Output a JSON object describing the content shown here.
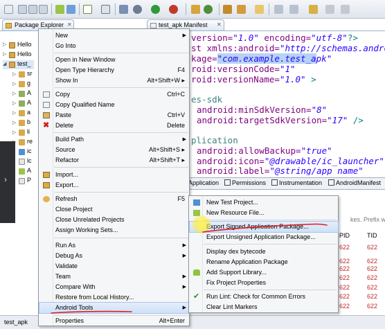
{
  "colors": {
    "menu_bg": "#f5f6f7",
    "hover_bg": "#cfe0f7",
    "annotation_red": "#e21b1b",
    "xml_attr": "#7f007f",
    "xml_string": "#2a00ff",
    "pid_red": "#c0282b"
  },
  "toolbar": {
    "icons": [
      "new-icon",
      "save-icon",
      "print-icon",
      "debug-icon",
      "run-icon",
      "search-icon",
      "forward-icon",
      "back-icon"
    ]
  },
  "package_explorer": {
    "tab_label": "Package Explorer",
    "close_glyph": "✕",
    "projects": [
      {
        "label": "Hello",
        "expanded": false
      },
      {
        "label": "Hello",
        "expanded": false
      },
      {
        "label": "test_",
        "expanded": true
      }
    ],
    "children": [
      {
        "label": "sr"
      },
      {
        "label": "g"
      },
      {
        "label": "A"
      },
      {
        "label": "A"
      },
      {
        "label": "a"
      },
      {
        "label": "b"
      },
      {
        "label": "li"
      },
      {
        "label": "re"
      },
      {
        "label": "ic"
      },
      {
        "label": "lc"
      },
      {
        "label": "A"
      },
      {
        "label": "P"
      }
    ]
  },
  "status_bar": {
    "text": "test_apk"
  },
  "editor": {
    "tab_label": "test_apk Manifest",
    "close_glyph": "✕",
    "lines": [
      {
        "attr": "version=",
        "str": "\"1.0\"",
        "rest_attr": " encoding=",
        "rest_str": "\"utf-8\"",
        "tail": "?>"
      },
      {
        "attr": "st xmlns:android=",
        "str": "\"http://schemas.android"
      },
      {
        "attr": "kage=",
        "hl": "\"com.example.test_a",
        "str": "pk\""
      },
      {
        "attr": "roid:versionCode=",
        "str": "\"1\""
      },
      {
        "attr": "roid:versionName=",
        "str": "\"1.0\"",
        "tail": " >"
      },
      {
        "text": "es-sdk"
      },
      {
        "attr": "android:minSdkVersion=",
        "str": "\"8\""
      },
      {
        "attr": "android:targetSdkVersion=",
        "str": "\"17\"",
        "tail": " />"
      },
      {
        "text": "plication"
      },
      {
        "attr": "android:allowBackup=",
        "str": "\"true\""
      },
      {
        "attr": "android:icon=",
        "str": "\"@drawable/ic_launcher\""
      },
      {
        "attr": "android:label=",
        "str": "\"@string/app_name\""
      }
    ],
    "manifest_tabs": [
      "Application",
      "Permissions",
      "Instrumentation",
      "AndroidManifest"
    ]
  },
  "lower_view": {
    "filter_hint": "kes. Prefix with p",
    "columns": [
      "PID",
      "TID"
    ],
    "pid_values": [
      "622",
      "622",
      "622",
      "622",
      "622",
      "622",
      "622"
    ],
    "tid_values": [
      "622",
      "622",
      "622",
      "622",
      "622",
      "622",
      "622"
    ]
  },
  "context_menu": {
    "items": [
      {
        "label": "New",
        "shortcut": "",
        "submenu": true,
        "icon": ""
      },
      {
        "label": "Go Into",
        "shortcut": "",
        "submenu": false,
        "icon": ""
      },
      {
        "label": "Open in New Window",
        "shortcut": "",
        "submenu": false,
        "icon": ""
      },
      {
        "label": "Open Type Hierarchy",
        "shortcut": "F4",
        "submenu": false,
        "icon": ""
      },
      {
        "label": "Show In",
        "shortcut": "Alt+Shift+W ▸",
        "submenu": false,
        "icon": ""
      },
      {
        "label": "Copy",
        "shortcut": "Ctrl+C",
        "submenu": false,
        "icon": "copy-icon"
      },
      {
        "label": "Copy Qualified Name",
        "shortcut": "",
        "submenu": false,
        "icon": "copy-qualified-icon"
      },
      {
        "label": "Paste",
        "shortcut": "Ctrl+V",
        "submenu": false,
        "icon": "paste-icon"
      },
      {
        "label": "Delete",
        "shortcut": "Delete",
        "submenu": false,
        "icon": "delete-icon"
      },
      {
        "label": "Build Path",
        "shortcut": "",
        "submenu": true,
        "icon": ""
      },
      {
        "label": "Source",
        "shortcut": "Alt+Shift+S ▸",
        "submenu": false,
        "icon": ""
      },
      {
        "label": "Refactor",
        "shortcut": "Alt+Shift+T ▸",
        "submenu": false,
        "icon": ""
      },
      {
        "label": "Import...",
        "shortcut": "",
        "submenu": false,
        "icon": "import-icon"
      },
      {
        "label": "Export...",
        "shortcut": "",
        "submenu": false,
        "icon": "export-icon"
      },
      {
        "label": "Refresh",
        "shortcut": "F5",
        "submenu": false,
        "icon": "refresh-icon"
      },
      {
        "label": "Close Project",
        "shortcut": "",
        "submenu": false,
        "icon": ""
      },
      {
        "label": "Close Unrelated Projects",
        "shortcut": "",
        "submenu": false,
        "icon": ""
      },
      {
        "label": "Assign Working Sets...",
        "shortcut": "",
        "submenu": false,
        "icon": ""
      },
      {
        "label": "Run As",
        "shortcut": "",
        "submenu": true,
        "icon": ""
      },
      {
        "label": "Debug As",
        "shortcut": "",
        "submenu": true,
        "icon": ""
      },
      {
        "label": "Validate",
        "shortcut": "",
        "submenu": false,
        "icon": ""
      },
      {
        "label": "Team",
        "shortcut": "",
        "submenu": true,
        "icon": ""
      },
      {
        "label": "Compare With",
        "shortcut": "",
        "submenu": true,
        "icon": ""
      },
      {
        "label": "Restore from Local History...",
        "shortcut": "",
        "submenu": false,
        "icon": ""
      },
      {
        "label": "Android Tools",
        "shortcut": "",
        "submenu": true,
        "icon": ""
      },
      {
        "label": "Properties",
        "shortcut": "Alt+Enter",
        "submenu": false,
        "icon": ""
      }
    ],
    "highlighted": "Android Tools"
  },
  "android_tools_menu": {
    "items": [
      {
        "label": "New Test Project...",
        "icon": "test-project-icon"
      },
      {
        "label": "New Resource File...",
        "icon": "resource-file-icon"
      },
      {
        "label": "Export Signed Application Package...",
        "icon": ""
      },
      {
        "label": "Export Unsigned Application Package...",
        "icon": ""
      },
      {
        "label": "Display dex bytecode",
        "icon": ""
      },
      {
        "label": "Rename Application Package",
        "icon": ""
      },
      {
        "label": "Add Support Library...",
        "icon": "android-icon"
      },
      {
        "label": "Fix Project Properties",
        "icon": ""
      },
      {
        "label": "Run Lint: Check for Common Errors",
        "icon": "lint-check-icon"
      },
      {
        "label": "Clear Lint Markers",
        "icon": ""
      }
    ],
    "highlighted": "Export Signed Application Package..."
  }
}
